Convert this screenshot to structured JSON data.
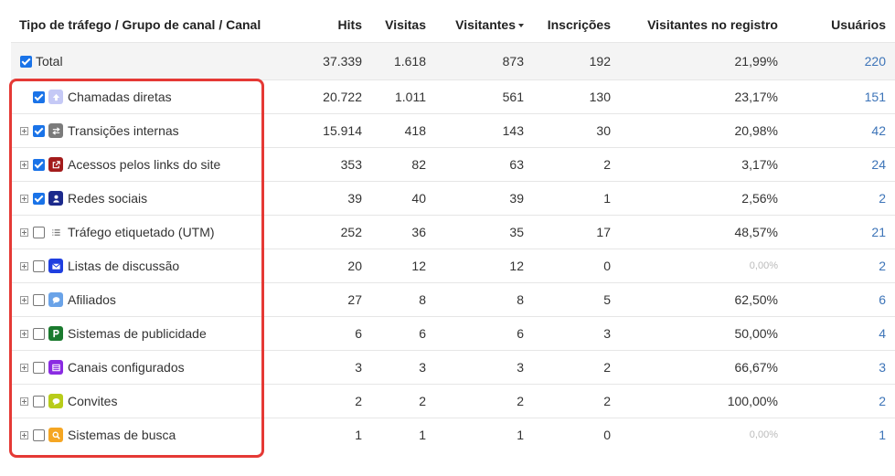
{
  "headers": {
    "channel": "Tipo de tráfego / Grupo de canal / Canal",
    "hits": "Hits",
    "visits": "Visitas",
    "visitors": "Visitantes",
    "signups": "Inscrições",
    "reg_visitors": "Visitantes no registro",
    "users": "Usuários"
  },
  "total": {
    "label": "Total",
    "hits": "37.339",
    "visits": "1.618",
    "visitors": "873",
    "signups": "192",
    "reg_visitors": "21,99%",
    "users": "220"
  },
  "rows": [
    {
      "label": "Chamadas diretas",
      "icon": "arrow-up-icon",
      "color": "#c5c9f6",
      "checked": true,
      "expandable": false,
      "hits": "20.722",
      "visits": "1.011",
      "visitors": "561",
      "signups": "130",
      "reg_visitors": "23,17%",
      "users": "151"
    },
    {
      "label": "Transições internas",
      "icon": "swap-arrows-icon",
      "color": "#7b7b7b",
      "checked": true,
      "expandable": true,
      "hits": "15.914",
      "visits": "418",
      "visitors": "143",
      "signups": "30",
      "reg_visitors": "20,98%",
      "users": "42"
    },
    {
      "label": "Acessos pelos links do site",
      "icon": "external-link-icon",
      "color": "#a31c1c",
      "checked": true,
      "expandable": true,
      "hits": "353",
      "visits": "82",
      "visitors": "63",
      "signups": "2",
      "reg_visitors": "3,17%",
      "users": "24"
    },
    {
      "label": "Redes sociais",
      "icon": "user-icon",
      "color": "#1c2a8c",
      "checked": true,
      "expandable": true,
      "hits": "39",
      "visits": "40",
      "visitors": "39",
      "signups": "1",
      "reg_visitors": "2,56%",
      "users": "2"
    },
    {
      "label": "Tráfego etiquetado (UTM)",
      "icon": "list-icon",
      "color": "#ffffff",
      "checked": false,
      "expandable": true,
      "hits": "252",
      "visits": "36",
      "visitors": "35",
      "signups": "17",
      "reg_visitors": "48,57%",
      "users": "21"
    },
    {
      "label": "Listas de discussão",
      "icon": "envelope-icon",
      "color": "#1f3fe0",
      "checked": false,
      "expandable": true,
      "hits": "20",
      "visits": "12",
      "visitors": "12",
      "signups": "0",
      "reg_visitors": "0,00%",
      "users": "2"
    },
    {
      "label": "Afiliados",
      "icon": "speech-bubble-icon",
      "color": "#6aa3e8",
      "checked": false,
      "expandable": true,
      "hits": "27",
      "visits": "8",
      "visitors": "8",
      "signups": "5",
      "reg_visitors": "62,50%",
      "users": "6"
    },
    {
      "label": "Sistemas de publicidade",
      "icon": "p-badge-icon",
      "color": "#1a7a2e",
      "checked": false,
      "expandable": true,
      "hits": "6",
      "visits": "6",
      "visitors": "6",
      "signups": "3",
      "reg_visitors": "50,00%",
      "users": "4"
    },
    {
      "label": "Canais configurados",
      "icon": "grid-icon",
      "color": "#8a2be2",
      "checked": false,
      "expandable": true,
      "hits": "3",
      "visits": "3",
      "visitors": "3",
      "signups": "2",
      "reg_visitors": "66,67%",
      "users": "3"
    },
    {
      "label": "Convites",
      "icon": "chat-icon",
      "color": "#b8cc1a",
      "checked": false,
      "expandable": true,
      "hits": "2",
      "visits": "2",
      "visitors": "2",
      "signups": "2",
      "reg_visitors": "100,00%",
      "users": "2"
    },
    {
      "label": "Sistemas de busca",
      "icon": "search-icon",
      "color": "#f5a623",
      "checked": false,
      "expandable": true,
      "hits": "1",
      "visits": "1",
      "visitors": "1",
      "signups": "0",
      "reg_visitors": "0,00%",
      "users": "1"
    }
  ],
  "colors": {
    "link": "#3d74b8",
    "checkbox": "#1a73e8",
    "highlight": "#e53935"
  }
}
